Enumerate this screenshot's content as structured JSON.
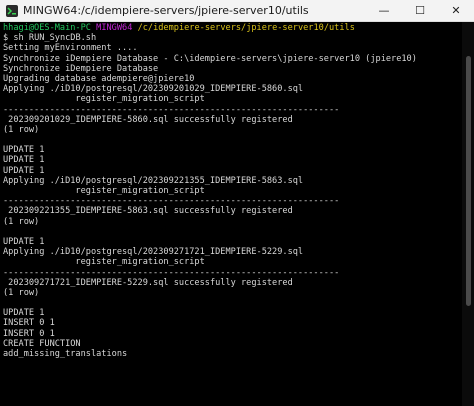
{
  "window": {
    "title": "MINGW64:/c/idempiere-servers/jpiere-server10/utils",
    "minimize": "—",
    "maximize": "☐",
    "close": "✕"
  },
  "prompt": {
    "user_host": "hhagi@OES-Main-PC",
    "env": "MINGW64",
    "path": "/c/idempiere-servers/jpiere-server10/utils",
    "symbol": "$",
    "command": "sh RUN_SyncDB.sh"
  },
  "output": [
    "Setting myEnvironment ....",
    "Synchronize iDempiere Database - C:\\idempiere-servers\\jpiere-server10 (jpiere10)",
    "Synchronize iDempiere Database",
    "Upgrading database adempiere@jpiere10",
    "Applying ./iD10/postgresql/202309201029_IDEMPIERE-5860.sql",
    "              register_migration_script",
    "-----------------------------------------------------------------",
    " 202309201029_IDEMPIERE-5860.sql successfully registered",
    "(1 row)",
    "",
    "UPDATE 1",
    "UPDATE 1",
    "UPDATE 1",
    "Applying ./iD10/postgresql/202309221355_IDEMPIERE-5863.sql",
    "              register_migration_script",
    "-----------------------------------------------------------------",
    " 202309221355_IDEMPIERE-5863.sql successfully registered",
    "(1 row)",
    "",
    "UPDATE 1",
    "Applying ./iD10/postgresql/202309271721_IDEMPIERE-5229.sql",
    "              register_migration_script",
    "-----------------------------------------------------------------",
    " 202309271721_IDEMPIERE-5229.sql successfully registered",
    "(1 row)",
    "",
    "UPDATE 1",
    "INSERT 0 1",
    "INSERT 0 1",
    "CREATE FUNCTION",
    "add_missing_translations"
  ],
  "colors": {
    "background": "#000000",
    "text": "#d8d8d8",
    "user_host": "#22c55e",
    "env": "#c026d3",
    "path": "#d9c21a"
  }
}
